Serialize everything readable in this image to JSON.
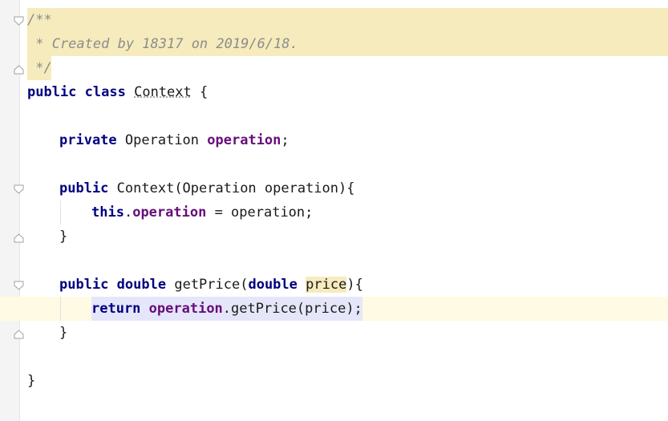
{
  "editor": {
    "doc_open": "/**",
    "doc_line": " * Created by 18317 on 2019/6/18.",
    "doc_close": " */",
    "class_kw1": "public",
    "class_kw2": "class",
    "class_name": "Context",
    "brace_open": " {",
    "field_kw": "private",
    "field_type": "Operation",
    "field_name": "operation",
    "semicolon": ";",
    "ctor_kw": "public",
    "ctor_sig": "Context(Operation operation){",
    "this_kw": "this",
    "dot": ".",
    "assign_field": "operation",
    "assign_rest": " = operation;",
    "close_brace": "}",
    "method_kw1": "public",
    "method_kw2": "double",
    "method_name": "getPrice(",
    "param_kw": "double",
    "param_name": "price",
    "method_tail": "){",
    "return_kw": "return",
    "return_field": "operation",
    "return_rest": ".getPrice(price);",
    "class_close": "}"
  }
}
